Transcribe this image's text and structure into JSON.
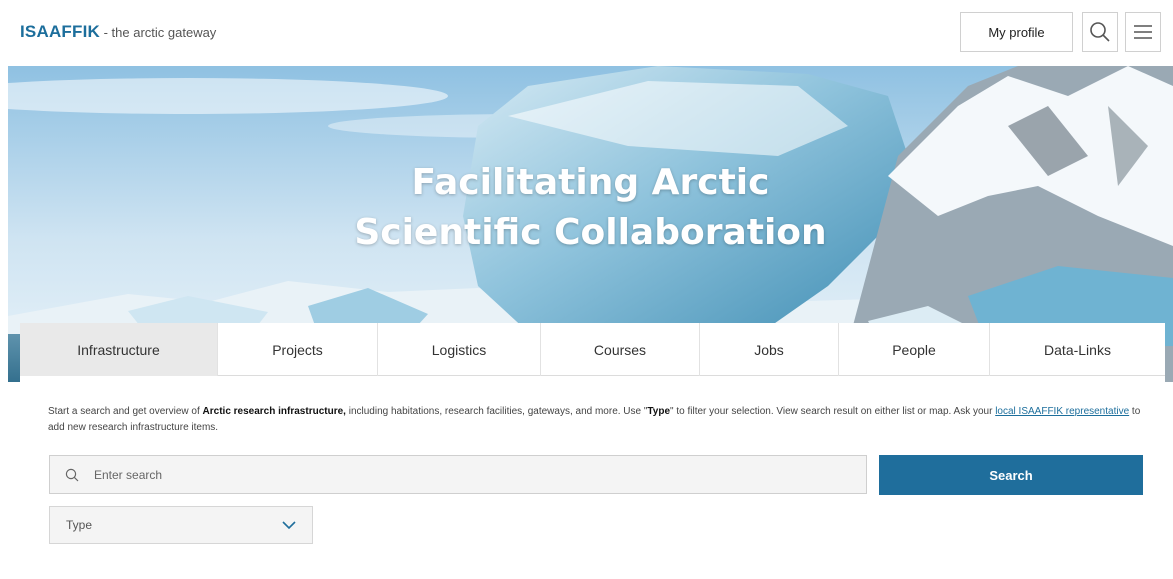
{
  "header": {
    "brand": "ISAAFFIK",
    "tagline": " - the arctic gateway",
    "profile_label": "My profile",
    "search_icon": "search-icon",
    "menu_icon": "hamburger-menu-icon"
  },
  "hero": {
    "title_line1": "Facilitating Arctic",
    "title_line2": "Scientific Collaboration"
  },
  "tabs": [
    {
      "label": "Infrastructure",
      "active": true
    },
    {
      "label": "Projects",
      "active": false
    },
    {
      "label": "Logistics",
      "active": false
    },
    {
      "label": "Courses",
      "active": false
    },
    {
      "label": "Jobs",
      "active": false
    },
    {
      "label": "People",
      "active": false
    },
    {
      "label": "Data-Links",
      "active": false
    }
  ],
  "intro": {
    "part1": "Start a search and get overview of ",
    "bold1": "Arctic research infrastructure,",
    "part2": " including habitations, research facilities, gateways, and more. Use \"",
    "bold2": "Type",
    "part3": "\" to filter your selection. View search result on either list or map. Ask your ",
    "link": "local ISAAFFIK representative",
    "part4": " to add new research infrastructure items."
  },
  "search": {
    "placeholder": "Enter search",
    "value": "",
    "button_label": "Search"
  },
  "filter": {
    "type_label": "Type"
  },
  "colors": {
    "brand": "#1c6e9c",
    "button": "#1f6e9c",
    "active_tab": "#e9e9e9"
  }
}
